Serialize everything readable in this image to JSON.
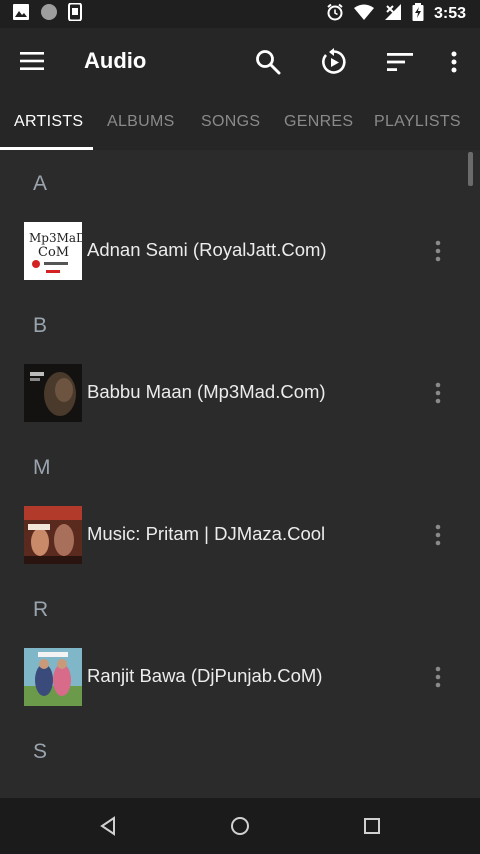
{
  "status_bar": {
    "time": "3:53",
    "left_icons": [
      "image-icon",
      "circle-icon",
      "phone-icon"
    ],
    "right_icons": [
      "alarm-icon",
      "wifi-icon",
      "signal-off-icon",
      "battery-charging-icon"
    ]
  },
  "app_bar": {
    "title": "Audio",
    "actions": [
      "search-icon",
      "resume-icon",
      "sort-icon",
      "more-vert-icon"
    ]
  },
  "tabs": [
    {
      "label": "ARTISTS",
      "active": true
    },
    {
      "label": "ALBUMS",
      "active": false
    },
    {
      "label": "SONGS",
      "active": false
    },
    {
      "label": "GENRES",
      "active": false
    },
    {
      "label": "PLAYLISTS",
      "active": false
    }
  ],
  "sections": [
    {
      "letter": "A",
      "artists": [
        {
          "name": "Adnan Sami (RoyalJatt.Com)",
          "art": "mp3mad-logo-art"
        }
      ]
    },
    {
      "letter": "B",
      "artists": [
        {
          "name": "Babbu Maan (Mp3Mad.Com)",
          "art": "dark-portrait-art"
        }
      ]
    },
    {
      "letter": "M",
      "artists": [
        {
          "name": "Music: Pritam | DJMaza.Cool",
          "art": "movie-poster-art"
        }
      ]
    },
    {
      "letter": "R",
      "artists": [
        {
          "name": "Ranjit Bawa (DjPunjab.CoM)",
          "art": "couple-poster-art"
        }
      ]
    },
    {
      "letter": "S",
      "artists": []
    }
  ],
  "nav_bar": [
    "back-icon",
    "home-icon",
    "recents-icon"
  ],
  "colors": {
    "background": "#2b2b2b",
    "toolbar": "#262626",
    "section_header": "#9aa4ae",
    "tab_inactive": "#8a8a8a",
    "tab_active": "#ffffff"
  }
}
